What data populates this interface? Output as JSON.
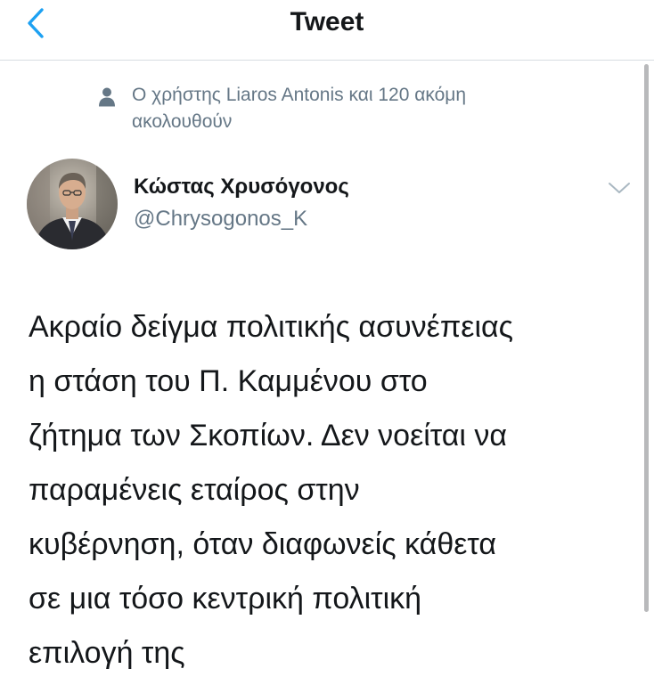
{
  "topbar": {
    "title": "Tweet",
    "back_icon": "chevron-left-icon"
  },
  "tweet": {
    "social_context": {
      "icon": "person-icon",
      "text": "Ο χρήστης Liaros Antonis και 120 ακόμη ακολουθούν"
    },
    "author": {
      "name": "Κώστας Χρυσόγονος",
      "handle": "@Chrysogonos_K"
    },
    "menu_icon": "chevron-down-icon",
    "text": "Ακραίο δείγμα πολιτικής ασυνέπειας\nη στάση του Π. Καμμένου στο\nζήτημα των Σκοπίων. Δεν νοείται να\nπαραμένεις εταίρος στην\nκυβέρνηση, όταν διαφωνείς κάθετα\nσε μια τόσο κεντρική πολιτική\nεπιλογή της"
  },
  "colors": {
    "accent": "#1da1f2",
    "secondary_text": "#657786",
    "primary_text": "#14171a",
    "divider": "#d8dde2"
  }
}
